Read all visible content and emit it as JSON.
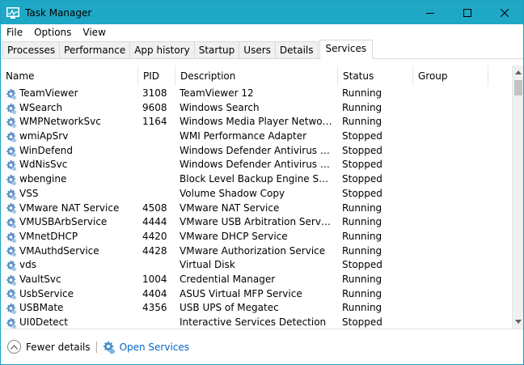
{
  "window": {
    "title": "Task Manager"
  },
  "menu": {
    "items": [
      "File",
      "Options",
      "View"
    ]
  },
  "tabs": [
    "Processes",
    "Performance",
    "App history",
    "Startup",
    "Users",
    "Details",
    "Services"
  ],
  "active_tab": "Services",
  "columns": {
    "name": "Name",
    "pid": "PID",
    "description": "Description",
    "status": "Status",
    "group": "Group"
  },
  "rows": [
    {
      "name": "TeamViewer",
      "pid": "3108",
      "description": "TeamViewer 12",
      "status": "Running"
    },
    {
      "name": "WSearch",
      "pid": "9608",
      "description": "Windows Search",
      "status": "Running"
    },
    {
      "name": "WMPNetworkSvc",
      "pid": "1164",
      "description": "Windows Media Player Network Sha...",
      "status": "Running"
    },
    {
      "name": "wmiApSrv",
      "pid": "",
      "description": "WMI Performance Adapter",
      "status": "Stopped"
    },
    {
      "name": "WinDefend",
      "pid": "",
      "description": "Windows Defender Antivirus Service",
      "status": "Stopped"
    },
    {
      "name": "WdNisSvc",
      "pid": "",
      "description": "Windows Defender Antivirus Networ...",
      "status": "Stopped"
    },
    {
      "name": "wbengine",
      "pid": "",
      "description": "Block Level Backup Engine Service",
      "status": "Stopped"
    },
    {
      "name": "VSS",
      "pid": "",
      "description": "Volume Shadow Copy",
      "status": "Stopped"
    },
    {
      "name": "VMware NAT Service",
      "pid": "4508",
      "description": "VMware NAT Service",
      "status": "Running"
    },
    {
      "name": "VMUSBArbService",
      "pid": "4444",
      "description": "VMware USB Arbitration Service",
      "status": "Running"
    },
    {
      "name": "VMnetDHCP",
      "pid": "4420",
      "description": "VMware DHCP Service",
      "status": "Running"
    },
    {
      "name": "VMAuthdService",
      "pid": "4428",
      "description": "VMware Authorization Service",
      "status": "Running"
    },
    {
      "name": "vds",
      "pid": "",
      "description": "Virtual Disk",
      "status": "Stopped"
    },
    {
      "name": "VaultSvc",
      "pid": "1004",
      "description": "Credential Manager",
      "status": "Running"
    },
    {
      "name": "UsbService",
      "pid": "4404",
      "description": "ASUS Virtual MFP Service",
      "status": "Running"
    },
    {
      "name": "USBMate",
      "pid": "4356",
      "description": "USB UPS of Megatec",
      "status": "Running"
    },
    {
      "name": "UI0Detect",
      "pid": "",
      "description": "Interactive Services Detection",
      "status": "Stopped"
    }
  ],
  "footer": {
    "fewer_details": "Fewer details",
    "open_services": "Open Services"
  },
  "colors": {
    "titlebar": "#1ea8c5",
    "link": "#0066cc"
  }
}
